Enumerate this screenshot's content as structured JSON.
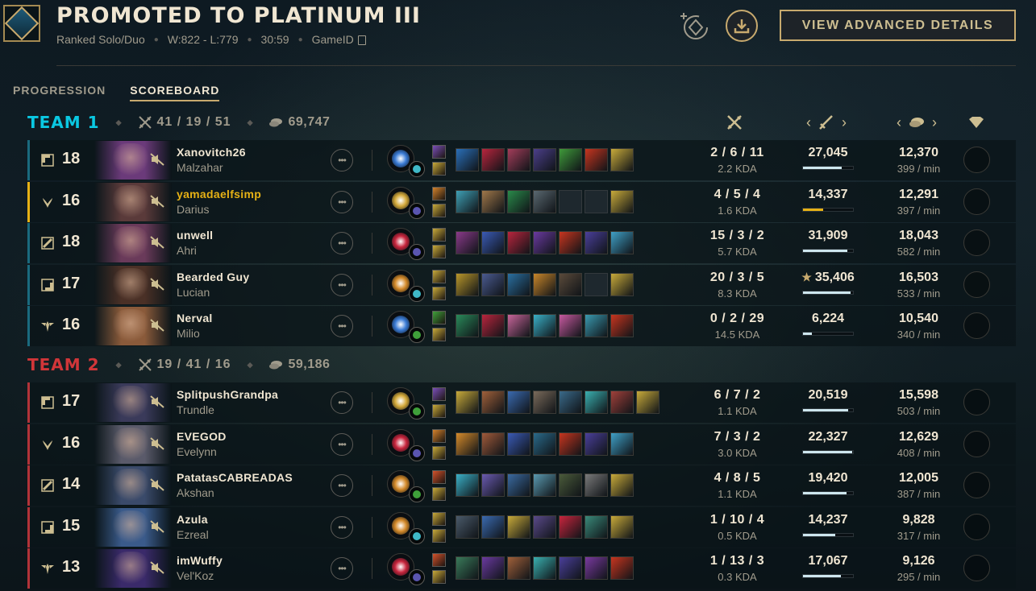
{
  "header": {
    "title": "PROMOTED TO PLATINUM III",
    "queue": "Ranked Solo/Duo",
    "record": "W:822 - L:779",
    "duration": "30:59",
    "game_id_label": "GameID",
    "advanced_label": "VIEW ADVANCED DETAILS"
  },
  "tabs": [
    {
      "label": "PROGRESSION",
      "active": false
    },
    {
      "label": "SCOREBOARD",
      "active": true
    }
  ],
  "teams": [
    {
      "name": "TEAM 1",
      "kda": "41 / 19 / 51",
      "gold": "69,747",
      "players": [
        {
          "position": "top",
          "level": "18",
          "name": "Xanovitch26",
          "champion": "Malzahar",
          "kda": "2 / 6 / 11",
          "kda_ratio": "2.2 KDA",
          "damage": "27,045",
          "damage_fraction": 0.77,
          "gold": "12,370",
          "gpm": "399 / min",
          "highlight": false,
          "star": false,
          "keystone_color": "#3a7bd5",
          "secondary_color": "#3fb8c7",
          "spell1": "#7a4fb8",
          "spell2": "#c8aa3a",
          "items": [
            "#2a6fb8",
            "#b8253d",
            "#a33d5a",
            "#4b3f8a",
            "#3f9a3a",
            "#c7351f",
            "#c8aa3a"
          ],
          "portrait": "#6b3a7a"
        },
        {
          "position": "jungle",
          "level": "16",
          "name": "yamadaelfsimp",
          "champion": "Darius",
          "kda": "4 / 5 / 4",
          "kda_ratio": "1.6 KDA",
          "damage": "14,337",
          "damage_fraction": 0.41,
          "gold": "12,291",
          "gpm": "397 / min",
          "highlight": true,
          "star": false,
          "keystone_color": "#d4a93a",
          "secondary_color": "#5a55b0",
          "spell1": "#d4822b",
          "spell2": "#c8aa3a",
          "items": [
            "#3fa0b5",
            "#a0784a",
            "#2a8a4a",
            "#5a6870",
            "",
            "",
            "#c8aa3a"
          ],
          "portrait": "#5a3a3a"
        },
        {
          "position": "mid",
          "level": "18",
          "name": "unwell",
          "champion": "Ahri",
          "kda": "15 / 3 / 2",
          "kda_ratio": "5.7 KDA",
          "damage": "31,909",
          "damage_fraction": 0.88,
          "gold": "18,043",
          "gpm": "582 / min",
          "highlight": false,
          "star": false,
          "keystone_color": "#c8253d",
          "secondary_color": "#5a55b0",
          "spell1": "#c8aa3a",
          "spell2": "#c8aa3a",
          "items": [
            "#8a3a8a",
            "#3a5ab5",
            "#b8253d",
            "#6a3aa0",
            "#c7351f",
            "#4a3f9a",
            "#3fa0c7"
          ],
          "portrait": "#6a3a5a"
        },
        {
          "position": "bottom",
          "level": "17",
          "name": "Bearded Guy",
          "champion": "Lucian",
          "kda": "20 / 3 / 5",
          "kda_ratio": "8.3 KDA",
          "damage": "35,406",
          "damage_fraction": 0.95,
          "gold": "16,503",
          "gpm": "533 / min",
          "highlight": false,
          "star": true,
          "keystone_color": "#d48a2a",
          "secondary_color": "#3fb8c7",
          "spell1": "#c8aa3a",
          "spell2": "#c8aa3a",
          "items": [
            "#b8962a",
            "#4a5a90",
            "#2a6fa0",
            "#c8862a",
            "#5a4a3a",
            "",
            "#c8aa3a"
          ],
          "portrait": "#4a3026"
        },
        {
          "position": "support",
          "level": "16",
          "name": "Nerval",
          "champion": "Milio",
          "kda": "0 / 2 / 29",
          "kda_ratio": "14.5 KDA",
          "damage": "6,224",
          "damage_fraction": 0.17,
          "gold": "10,540",
          "gpm": "340 / min",
          "highlight": false,
          "star": false,
          "keystone_color": "#3a7bd5",
          "secondary_color": "#3fa03a",
          "spell1": "#3fa03a",
          "spell2": "#c8aa3a",
          "items": [
            "#2a8a5a",
            "#b8253d",
            "#c7659a",
            "#3ab0c7",
            "#c75aa0",
            "#3a9ab0",
            "#c7351f"
          ],
          "portrait": "#8a5a3a"
        }
      ]
    },
    {
      "name": "TEAM 2",
      "kda": "19 / 41 / 16",
      "gold": "59,186",
      "players": [
        {
          "position": "top",
          "level": "17",
          "name": "SplitpushGrandpa",
          "champion": "Trundle",
          "kda": "6 / 7 / 2",
          "kda_ratio": "1.1 KDA",
          "damage": "20,519",
          "damage_fraction": 0.91,
          "gold": "15,598",
          "gpm": "503 / min",
          "highlight": false,
          "star": false,
          "keystone_color": "#d4a93a",
          "secondary_color": "#3fa03a",
          "spell1": "#7a4fb8",
          "spell2": "#c8aa3a",
          "items": [
            "#c8aa3a",
            "#a0603a",
            "#3a6ab0",
            "#7a6a5a",
            "#3a6a8a",
            "#3ab0b0",
            "#a0403a",
            "#c8aa3a"
          ],
          "portrait": "#3a3a5a"
        },
        {
          "position": "jungle",
          "level": "16",
          "name": "EVEGOD",
          "champion": "Evelynn",
          "kda": "7 / 3 / 2",
          "kda_ratio": "3.0 KDA",
          "damage": "22,327",
          "damage_fraction": 0.99,
          "gold": "12,629",
          "gpm": "408 / min",
          "highlight": false,
          "star": false,
          "keystone_color": "#c8253d",
          "secondary_color": "#5a55b0",
          "spell1": "#d4822b",
          "spell2": "#c8aa3a",
          "items": [
            "#d48a2a",
            "#a05a3a",
            "#3a5ab5",
            "#2a6a8a",
            "#c7351f",
            "#4a3f9a",
            "#3fa0c7"
          ],
          "portrait": "#5a5a6a"
        },
        {
          "position": "mid",
          "level": "14",
          "name": "PatatasCABREADAS",
          "champion": "Akshan",
          "kda": "4 / 8 / 5",
          "kda_ratio": "1.1 KDA",
          "damage": "19,420",
          "damage_fraction": 0.87,
          "gold": "12,005",
          "gpm": "387 / min",
          "highlight": false,
          "star": false,
          "keystone_color": "#d48a2a",
          "secondary_color": "#3fa03a",
          "spell1": "#d4522b",
          "spell2": "#c8aa3a",
          "items": [
            "#3ab0c7",
            "#6a5ab0",
            "#3a6aa0",
            "#5a9ab0",
            "#4a5a3a",
            "#7a7a7a",
            "#c8aa3a"
          ],
          "portrait": "#3a4a6a"
        },
        {
          "position": "bottom",
          "level": "15",
          "name": "Azula",
          "champion": "Ezreal",
          "kda": "1 / 10 / 4",
          "kda_ratio": "0.5 KDA",
          "damage": "14,237",
          "damage_fraction": 0.64,
          "gold": "9,828",
          "gpm": "317 / min",
          "highlight": false,
          "star": false,
          "keystone_color": "#d48a2a",
          "secondary_color": "#3fb8c7",
          "spell1": "#c8aa3a",
          "spell2": "#c8aa3a",
          "items": [
            "#4a5a6a",
            "#3a6ab0",
            "#c8aa3a",
            "#5a4a8a",
            "#c8253d",
            "#3a8a7a",
            "#c8aa3a"
          ],
          "portrait": "#3a5a8a"
        },
        {
          "position": "support",
          "level": "13",
          "name": "imWuffy",
          "champion": "Vel'Koz",
          "kda": "1 / 13 / 3",
          "kda_ratio": "0.3 KDA",
          "damage": "17,067",
          "damage_fraction": 0.76,
          "gold": "9,126",
          "gpm": "295 / min",
          "highlight": false,
          "star": false,
          "keystone_color": "#c8253d",
          "secondary_color": "#5a55b0",
          "spell1": "#d4522b",
          "spell2": "#c8aa3a",
          "items": [
            "#3a7a5a",
            "#6a3aa0",
            "#a0603a",
            "#3ab0b0",
            "#4a3f9a",
            "#7a3aa0",
            "#c7351f"
          ],
          "portrait": "#3a2a6a"
        }
      ]
    }
  ],
  "icons": {
    "kda": "crossed-swords-icon",
    "gold": "gold-coins-icon",
    "damage": "sword-icon",
    "honor": "honor-icon",
    "mute": "mute-icon",
    "more": "more-options-icon",
    "copy": "copy-icon",
    "download": "download-icon"
  },
  "colors": {
    "team1": "#0ac8e2",
    "team2": "#d13639",
    "accent": "#c8aa6e",
    "highlight": "#e6b115"
  }
}
